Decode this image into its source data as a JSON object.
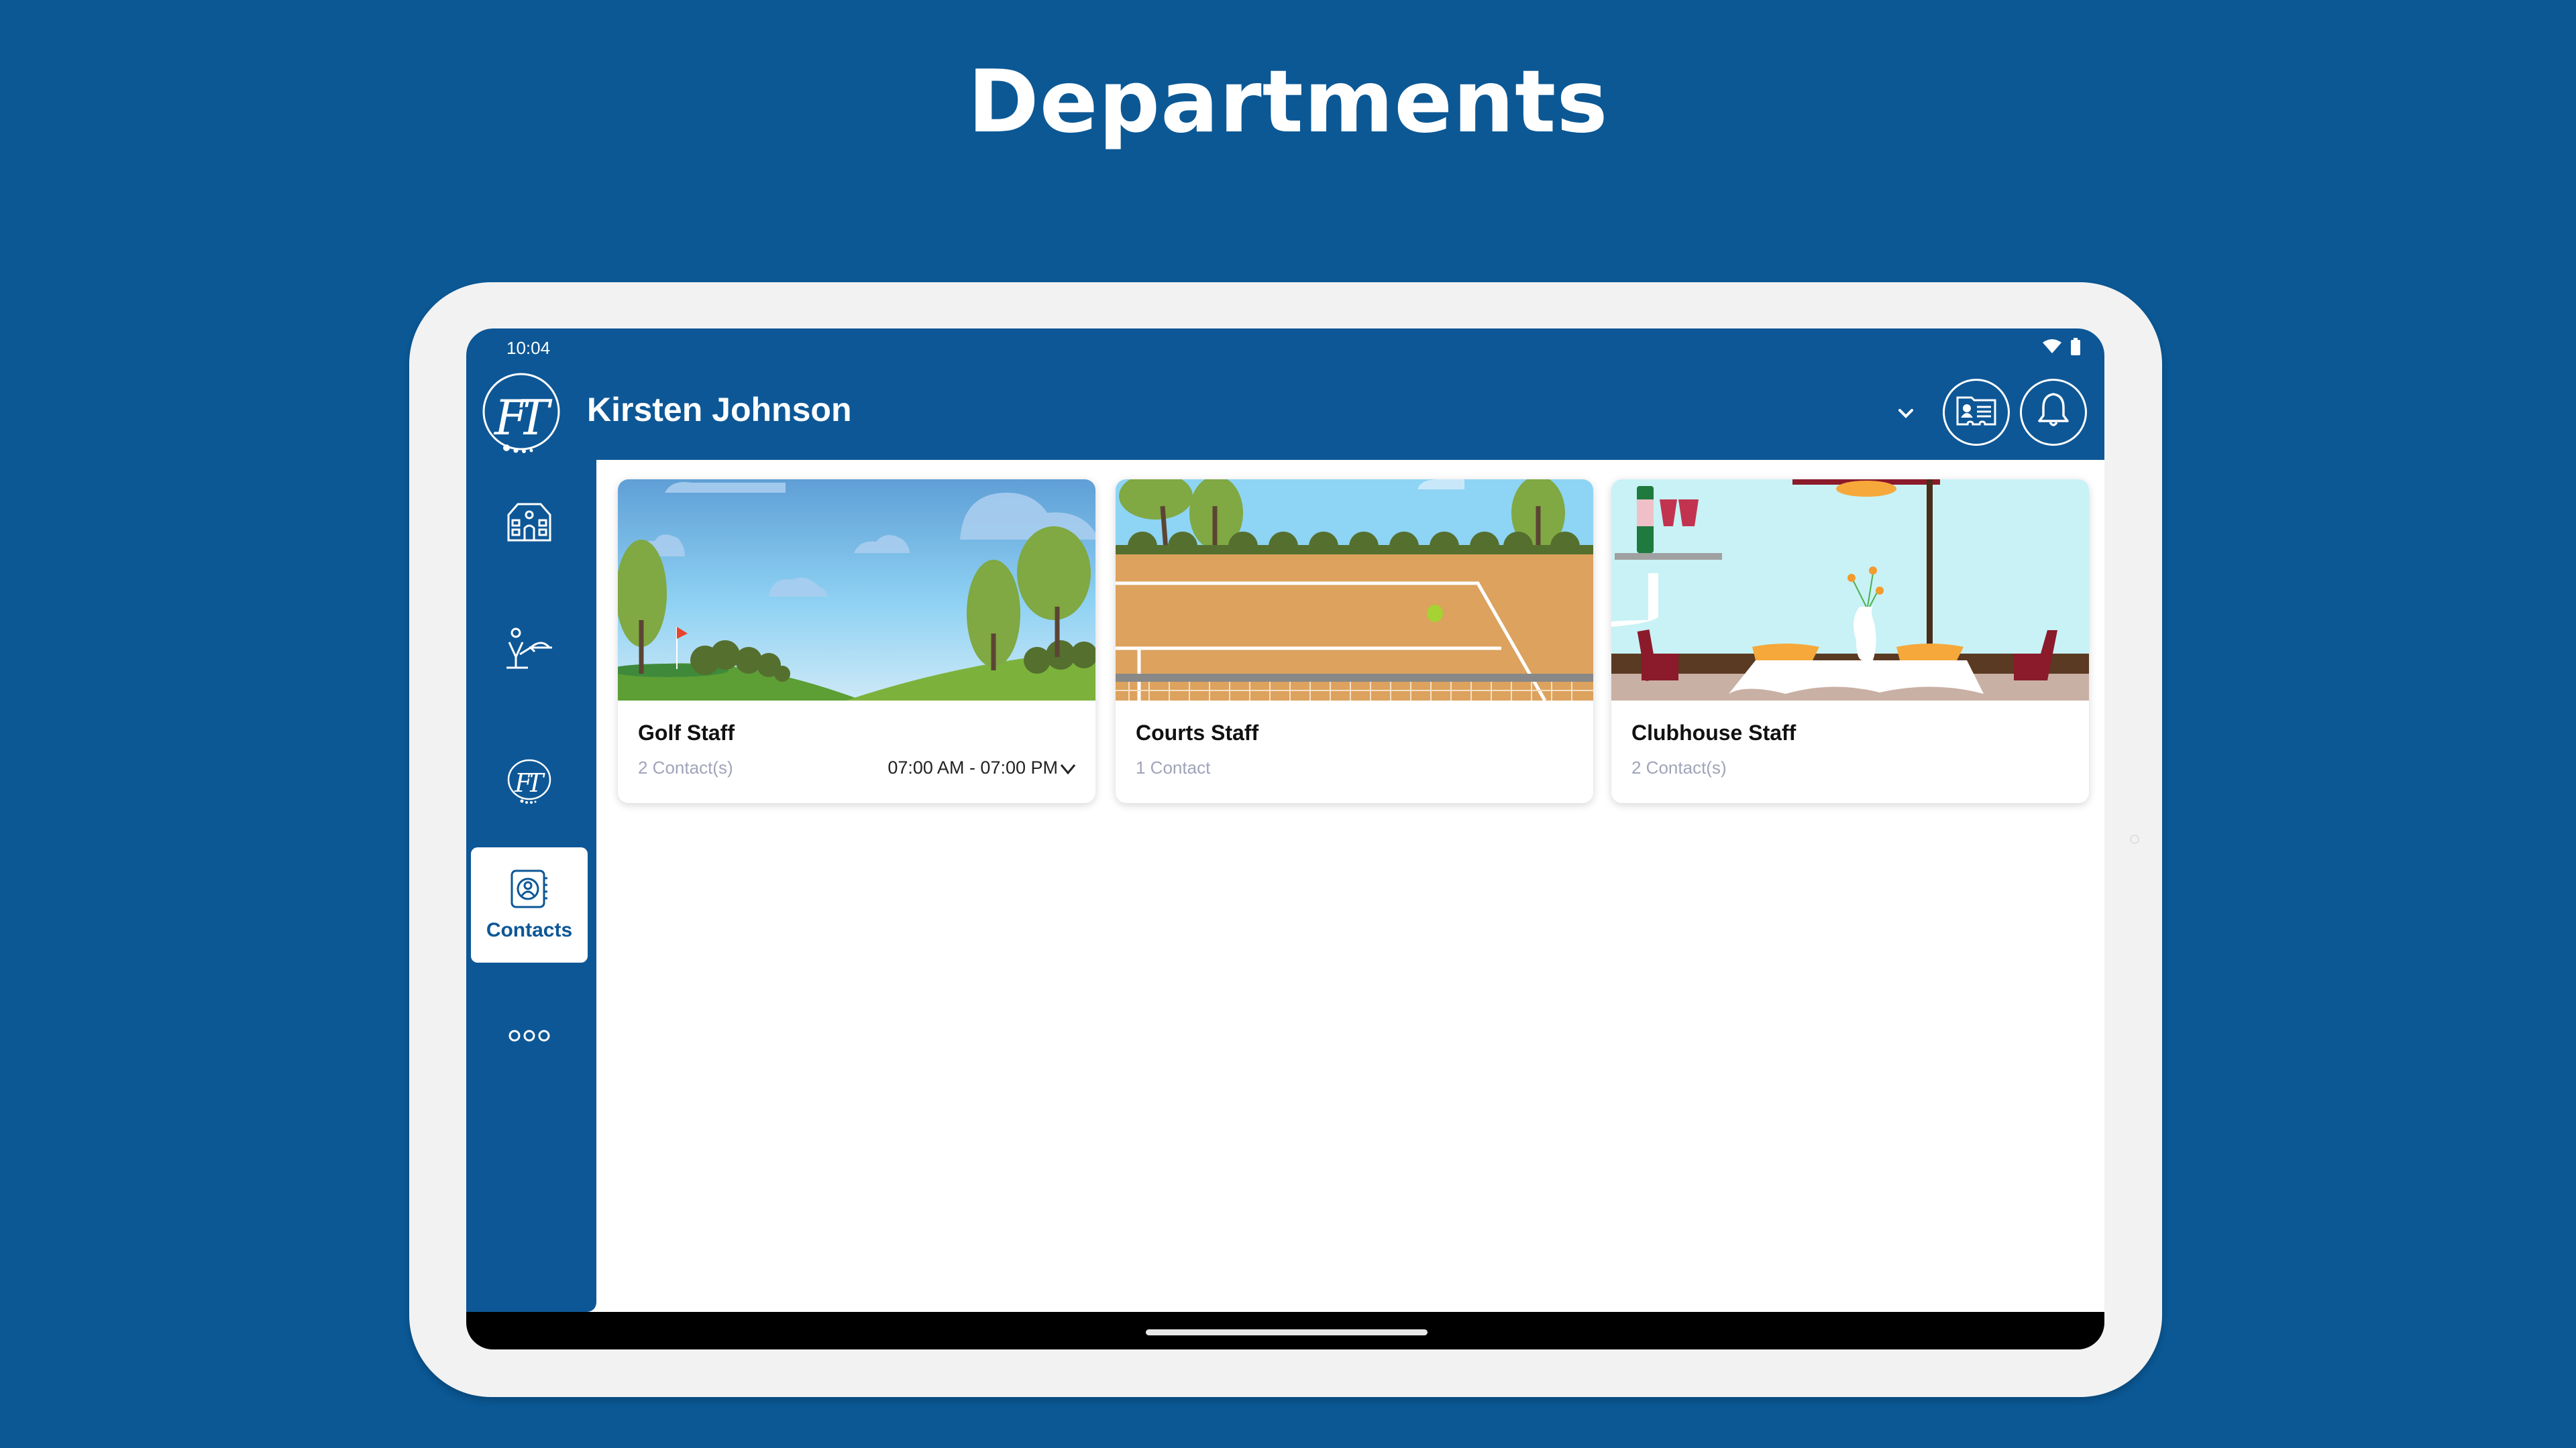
{
  "page": {
    "title": "Departments"
  },
  "status_bar": {
    "time": "10:04",
    "icons": [
      "wifi-icon",
      "battery-icon"
    ]
  },
  "header": {
    "logo": "FT",
    "user_name": "Kirsten Johnson",
    "account_dropdown_icon": "chevron-down-icon",
    "buttons": [
      {
        "name": "contact-card-button",
        "icon": "id-card-icon"
      },
      {
        "name": "notifications-button",
        "icon": "bell-icon"
      }
    ]
  },
  "sidebar": {
    "items": [
      {
        "name": "clubhouse",
        "icon": "building-icon",
        "label": ""
      },
      {
        "name": "dining",
        "icon": "waiter-icon",
        "label": ""
      },
      {
        "name": "ft-club",
        "icon": "ft-logo-icon",
        "label": ""
      },
      {
        "name": "contacts",
        "icon": "contacts-book-icon",
        "label": "Contacts",
        "active": true
      },
      {
        "name": "more",
        "icon": "more-dots-icon",
        "label": ""
      }
    ]
  },
  "departments": [
    {
      "title": "Golf Staff",
      "contacts": "2 Contact(s)",
      "hours": "07:00 AM - 07:00 PM",
      "image": "golf-course-illustration"
    },
    {
      "title": "Courts Staff",
      "contacts": "1 Contact",
      "hours": "",
      "image": "tennis-court-illustration"
    },
    {
      "title": "Clubhouse Staff",
      "contacts": "2 Contact(s)",
      "hours": "",
      "image": "dining-table-illustration"
    }
  ],
  "colors": {
    "brand_blue": "#0d5796",
    "background_blue": "#0b5895",
    "muted_text": "#a0a4b8"
  }
}
